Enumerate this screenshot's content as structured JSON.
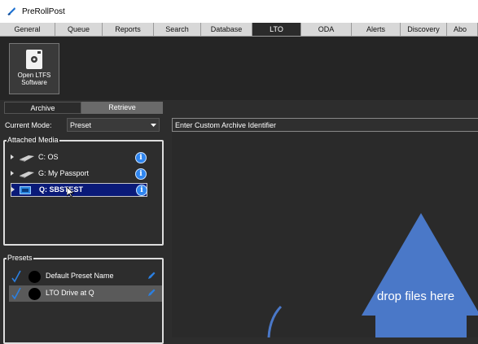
{
  "app": {
    "title": "PreRollPost"
  },
  "tabs": [
    {
      "label": "General"
    },
    {
      "label": "Queue"
    },
    {
      "label": "Reports"
    },
    {
      "label": "Search"
    },
    {
      "label": "Database"
    },
    {
      "label": "LTO"
    },
    {
      "label": "ODA"
    },
    {
      "label": "Alerts"
    },
    {
      "label": "Discovery"
    },
    {
      "label": "Abo"
    }
  ],
  "active_tab": "LTO",
  "toolbar": {
    "open_ltfs_label": "Open LTFS Software"
  },
  "subtabs": {
    "archive": "Archive",
    "retrieve": "Retrieve",
    "active": "Archive"
  },
  "mode": {
    "label": "Current Mode:",
    "value": "Preset"
  },
  "identifier": {
    "placeholder": "Enter Custom Archive Identifier"
  },
  "attached_media": {
    "title": "Attached Media",
    "items": [
      {
        "name": "C: OS",
        "icon": "usb-drive-icon",
        "selected": false
      },
      {
        "name": "G: My Passport",
        "icon": "usb-drive-icon",
        "selected": false
      },
      {
        "name": "Q: SBSTEST",
        "icon": "tape-drive-icon",
        "selected": true
      }
    ]
  },
  "presets": {
    "title": "Presets",
    "items": [
      {
        "name": "Default Preset Name",
        "checked": true,
        "selected": false
      },
      {
        "name": "LTO Drive at Q",
        "checked": true,
        "selected": true
      }
    ]
  },
  "dropzone": {
    "label": "drop files here"
  },
  "colors": {
    "selection": "#0a1a78",
    "info": "#2f86f0",
    "arrow": "#4a78c8",
    "check": "#2b7fe0"
  }
}
